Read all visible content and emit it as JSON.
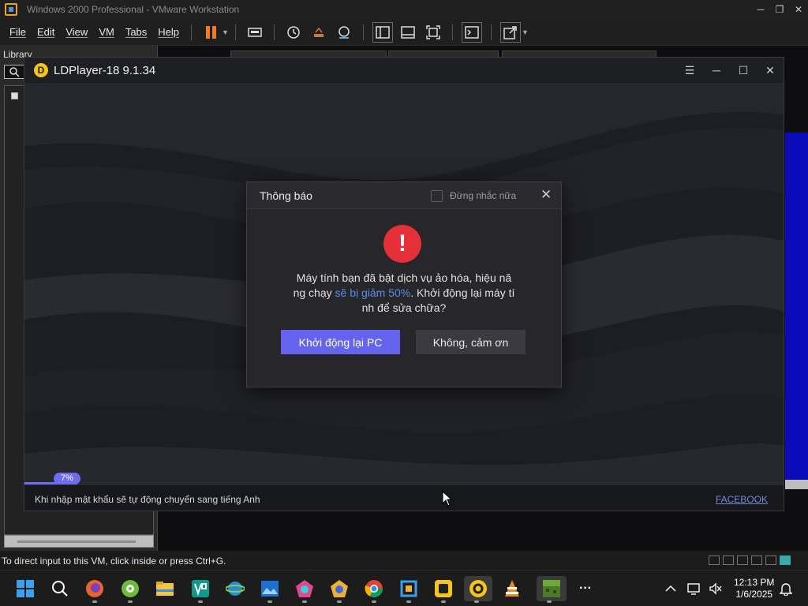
{
  "vmware": {
    "window_title": "Windows 2000 Professional - VMware Workstation",
    "menu": [
      "File",
      "Edit",
      "View",
      "VM",
      "Tabs",
      "Help"
    ],
    "library_label": "Library",
    "status_message": "To direct input to this VM, click inside or press Ctrl+G."
  },
  "ldplayer": {
    "title": "LDPlayer-18 9.1.34",
    "progress_percent": 7,
    "progress_label": "7%",
    "status_hint": "Khi nhập mật khẩu sẽ tự động chuyển sang tiếng Anh",
    "facebook_link": "FACEBOOK"
  },
  "dialog": {
    "title": "Thông báo",
    "dont_remind": "Đừng nhắc nữa",
    "alert_symbol": "!",
    "message_part1": "Máy tính bạn đã bật dịch vụ ảo hóa, hiệu nă",
    "message_part2": "ng chạy ",
    "message_highlight": "sẽ bị giảm 50%",
    "message_part3": ". Khởi động lại máy tí",
    "message_part4": "nh để sửa chữa?",
    "restart_button": "Khởi động lại PC",
    "decline_button": "Không, cảm ơn"
  },
  "taskbar": {
    "time": "12:13 PM",
    "date": "1/6/2025",
    "overflow": "···"
  },
  "colors": {
    "accent": "#6464f0",
    "alert": "#e5303a",
    "highlight": "#5b8de8"
  }
}
